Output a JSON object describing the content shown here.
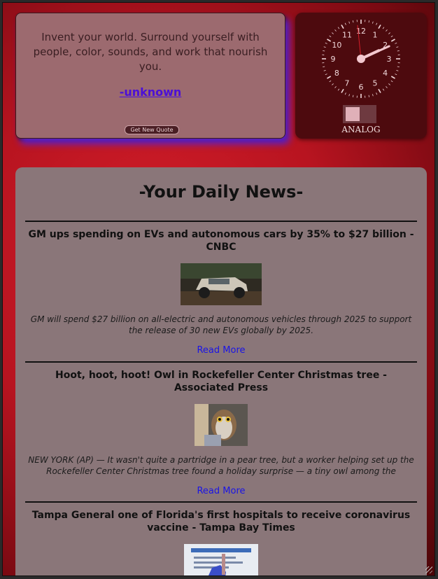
{
  "quote": {
    "text": "Invent your world. Surround yourself with people, color, sounds, and work that nourish you.",
    "author": "-unknown",
    "button_label": "Get New Quote"
  },
  "clock": {
    "numbers": [
      "12",
      "1",
      "2",
      "3",
      "4",
      "5",
      "6",
      "7",
      "8",
      "9",
      "10",
      "11"
    ],
    "time": {
      "hour": 2,
      "minute": 10,
      "second": 59
    },
    "toggle_label": "ANALOG"
  },
  "news": {
    "heading": "-Your Daily News-",
    "articles": [
      {
        "title": "GM ups spending on EVs and autonomous cars by 35% to $27 billion - CNBC",
        "description": "GM will spend $27 billion on all-electric and autonomous vehicles through 2025 to support the release of 30 new EVs globally by 2025.",
        "read_more": "Read More"
      },
      {
        "title": "Hoot, hoot, hoot! Owl in Rockefeller Center Christmas tree - Associated Press",
        "description": "NEW YORK (AP) — It wasn't quite a partridge in a pear tree, but a worker helping set up the Rockefeller Center Christmas tree found a holiday surprise — a tiny owl among the massive…",
        "read_more": "Read More"
      },
      {
        "title": "Tampa General one of Florida's first hospitals to receive coronavirus vaccine - Tampa Bay Times",
        "description": "",
        "read_more": ""
      }
    ]
  },
  "colors": {
    "background_red": "#c4141f",
    "card_mauve": "#8a7679",
    "clock_card": "#4d0a0e",
    "link_blue": "#1a14e6",
    "author_purple": "#4b0fd8"
  }
}
